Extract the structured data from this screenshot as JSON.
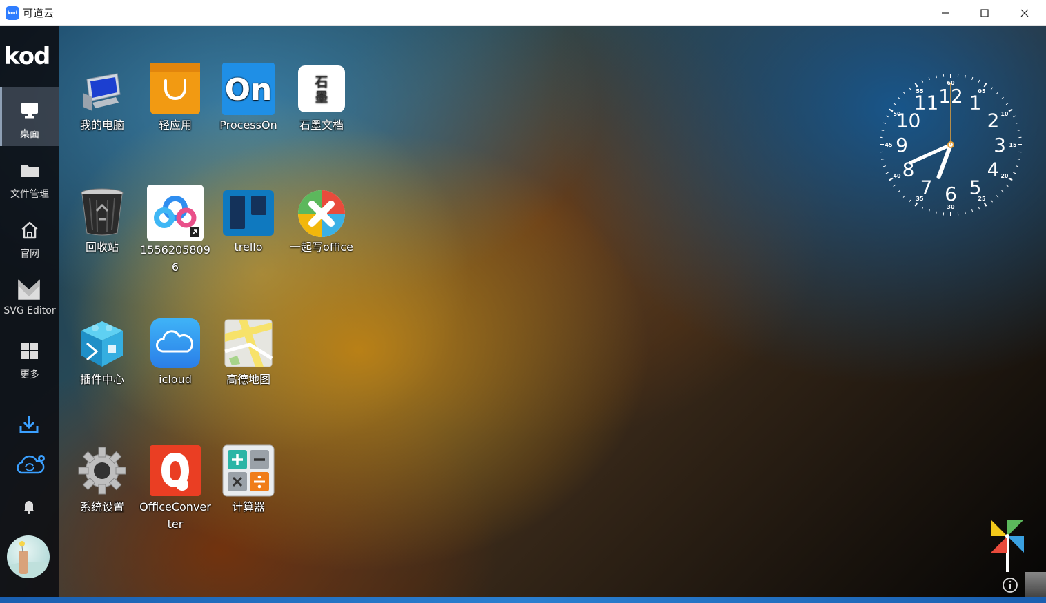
{
  "window": {
    "title": "可道云",
    "app_badge": "kod"
  },
  "sidebar": {
    "logo": "kod",
    "items": [
      {
        "label": "桌面",
        "icon": "monitor-icon",
        "active": true
      },
      {
        "label": "文件管理",
        "icon": "folder-icon"
      },
      {
        "label": "官网",
        "icon": "home-icon"
      },
      {
        "label": "SVG Editor",
        "icon": "svg-editor-icon"
      },
      {
        "label": "更多",
        "icon": "grid-icon"
      }
    ],
    "tools": [
      "download-icon",
      "cloud-settings-icon",
      "bell-icon"
    ]
  },
  "desktop": {
    "icons": [
      {
        "label": "我的电脑",
        "icon": "computer-icon"
      },
      {
        "label": "轻应用",
        "icon": "shopping-bag-icon"
      },
      {
        "label": "ProcessOn",
        "icon": "processon-icon",
        "text": "On"
      },
      {
        "label": "石墨文档",
        "icon": "shimo-icon",
        "text": "石\n墨"
      },
      {
        "label": "回收站",
        "icon": "recycle-bin-icon"
      },
      {
        "label": "15562058096",
        "icon": "baidu-cloud-icon"
      },
      {
        "label": "trello",
        "icon": "trello-icon"
      },
      {
        "label": "一起写office",
        "icon": "yiqixie-icon"
      },
      {
        "label": "插件中心",
        "icon": "plugin-cube-icon"
      },
      {
        "label": "icloud",
        "icon": "icloud-icon"
      },
      {
        "label": "高德地图",
        "icon": "map-icon"
      },
      {
        "label": "系统设置",
        "icon": "gear-icon"
      },
      {
        "label": "OfficeConverter",
        "icon": "office-converter-icon"
      },
      {
        "label": "计算器",
        "icon": "calculator-icon"
      }
    ]
  },
  "clock": {
    "hours": [
      "12",
      "1",
      "2",
      "3",
      "4",
      "5",
      "6",
      "7",
      "8",
      "9",
      "10",
      "11"
    ],
    "minutes": [
      "60",
      "05",
      "10",
      "15",
      "20",
      "25",
      "30",
      "35",
      "40",
      "45",
      "50",
      "55"
    ],
    "time": {
      "hour": 6,
      "minute": 41,
      "second": 0
    }
  },
  "colors": {
    "accent": "#2f7dff",
    "sidebar_bg": "#0c0e12",
    "taskbar": "#1a5fb0"
  }
}
